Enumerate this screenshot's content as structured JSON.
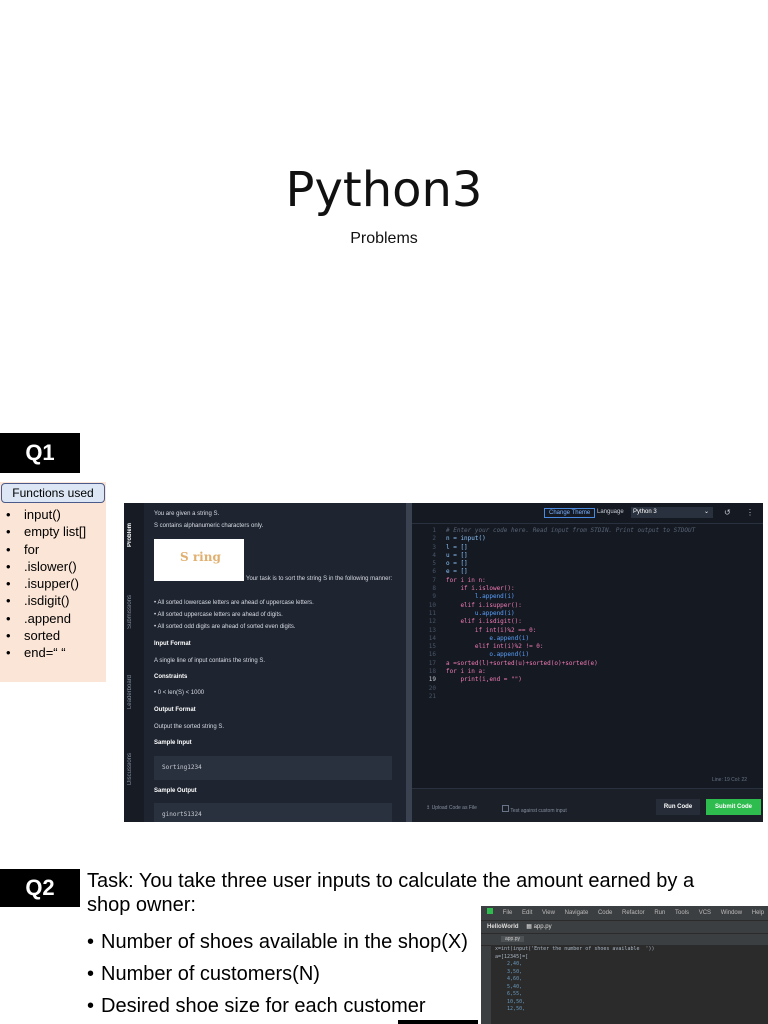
{
  "title": "Python3",
  "subtitle": "Problems",
  "q1": {
    "tag": "Q1",
    "functions_header": "Functions used",
    "functions": [
      "input()",
      "empty list[]",
      "for",
      ".islower()",
      ".isupper()",
      ".isdigit()",
      ".append",
      "sorted",
      "end=“ “"
    ]
  },
  "hackerrank": {
    "tabs": [
      "Problem",
      "Submissions",
      "Leaderboard",
      "Discussions"
    ],
    "problem": {
      "intro1": "You are given a string S.",
      "intro2": "S contains alphanumeric characters only.",
      "image_text": "S ring",
      "task": "Your task is to sort the string S in the following manner:",
      "rules": [
        "All sorted lowercase letters are ahead of uppercase letters.",
        "All sorted uppercase letters are ahead of digits.",
        "All sorted odd digits are ahead of sorted even digits."
      ],
      "input_format_title": "Input Format",
      "input_format": "A single line of input contains the string S.",
      "constraints_title": "Constraints",
      "constraints": "0 < len(S) < 1000",
      "output_format_title": "Output Format",
      "output_format": "Output the sorted string S.",
      "sample_input_title": "Sample Input",
      "sample_input": "Sorting1234",
      "sample_output_title": "Sample Output",
      "sample_output": "ginortS1324"
    },
    "editor": {
      "change_theme": "Change Theme",
      "language_label": "Language",
      "language": "Python 3",
      "code_lines": [
        "# Enter your code here. Read input from STDIN. Print output to STDOUT",
        "n = input()",
        "l = []",
        "u = []",
        "o = []",
        "e = []",
        "for i in n:",
        "    if i.islower():",
        "        l.append(i)",
        "    elif i.isupper():",
        "        u.append(i)",
        "    elif i.isdigit():",
        "        if int(i)%2 == 0:",
        "            e.append(i)",
        "        elif int(i)%2 != 0:",
        "            o.append(i)",
        "a =sorted(l)+sorted(u)+sorted(o)+sorted(e)",
        "for i in a:",
        "    print(i,end = \"\")",
        "",
        ""
      ],
      "status": "Line: 19 Col: 22",
      "upload_label": "Upload Code as File",
      "test_label": "Test against custom input",
      "run_label": "Run Code",
      "submit_label": "Submit Code"
    }
  },
  "q2": {
    "tag": "Q2",
    "task": "Task: You take three user inputs to calculate the amount earned by a shop owner:",
    "bullets": [
      "Number of shoes available in the shop(X)",
      "Number of customers(N)",
      "Desired shoe size for each customer"
    ],
    "ide": {
      "menu": [
        "File",
        "Edit",
        "View",
        "Navigate",
        "Code",
        "Refactor",
        "Run",
        "Tools",
        "VCS",
        "Window",
        "Help"
      ],
      "project": "HelloWorld",
      "file": "app.py",
      "code_lines": [
        "x=int(input('Enter the number of shoes available  '))",
        "a=[12345]=[",
        "    2,40,",
        "    3,50,",
        "    4,60,",
        "    5,40,",
        "    6,55,",
        "    10,50,",
        "    12,50,"
      ]
    }
  }
}
